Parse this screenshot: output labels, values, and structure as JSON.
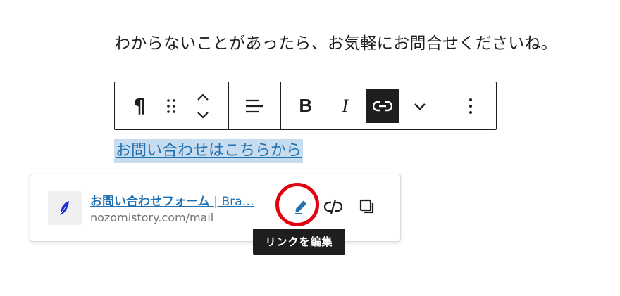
{
  "paragraph": {
    "text": "わからないことがあったら、お気軽にお問合せくださいね。"
  },
  "toolbar": {
    "paragraph_icon": "¶",
    "bold_label": "B",
    "italic_label": "I",
    "buttons": [
      "paragraph-icon",
      "drag-handle-icon",
      "move-up-down-icon",
      "align-left-icon",
      "bold-icon",
      "italic-icon",
      "link-icon",
      "chevron-down-icon",
      "more-options-icon"
    ],
    "active_color": "#1e1e1e"
  },
  "editor": {
    "linked_text": "お問い合わせはこちらから"
  },
  "link_popover": {
    "title": "お問い合わせフォーム",
    "title_suffix": "| Bra…",
    "url": "nozomistory.com/mail",
    "favicon": "feather-icon",
    "actions": [
      "edit-icon",
      "unlink-icon",
      "copy-icon"
    ],
    "link_color": "#2271b1"
  },
  "tooltip": {
    "text": "リンクを編集"
  },
  "annotation": {
    "ring_color": "#e1000f"
  }
}
